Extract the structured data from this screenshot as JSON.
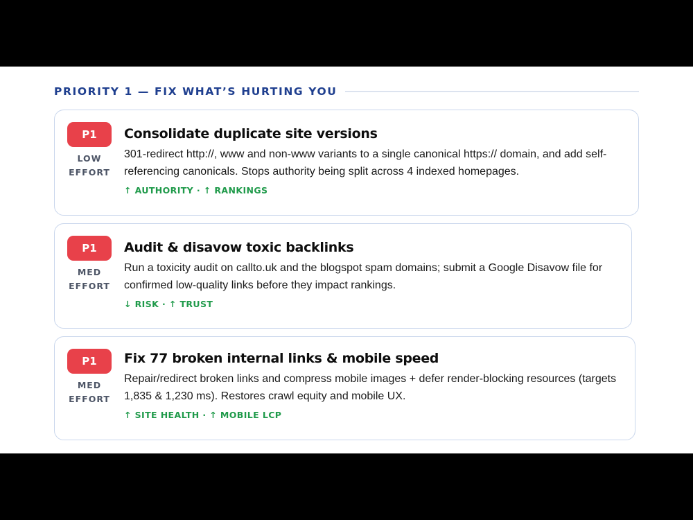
{
  "section": {
    "title": "PRIORITY 1 — FIX WHAT’S HURTING YOU"
  },
  "colors": {
    "heading": "#1f3f8f",
    "badge": "#e8414a",
    "tag": "#1f9a4a",
    "card_border": "#c9d6ec"
  },
  "cards": [
    {
      "badge": "P1",
      "effort_line1": "LOW",
      "effort_line2": "EFFORT",
      "title": "Consolidate duplicate site versions",
      "description": "301-redirect http://, www and non-www variants to a single canonical https:// domain, and add self-referencing canonicals. Stops authority being split across 4 indexed homepages.",
      "tags": "↑ AUTHORITY · ↑ RANKINGS"
    },
    {
      "badge": "P1",
      "effort_line1": "MED",
      "effort_line2": "EFFORT",
      "title": "Audit & disavow toxic backlinks",
      "description": "Run a toxicity audit on callto.uk and the blogspot spam domains; submit a Google Disavow file for confirmed low-quality links before they impact rankings.",
      "tags": "↓ RISK · ↑ TRUST"
    },
    {
      "badge": "P1",
      "effort_line1": "MED",
      "effort_line2": "EFFORT",
      "title": "Fix 77 broken internal links & mobile speed",
      "description": "Repair/redirect broken links and compress mobile images + defer render-blocking resources (targets 1,835 & 1,230 ms). Restores crawl equity and mobile UX.",
      "tags": "↑ SITE HEALTH · ↑ MOBILE LCP"
    }
  ]
}
